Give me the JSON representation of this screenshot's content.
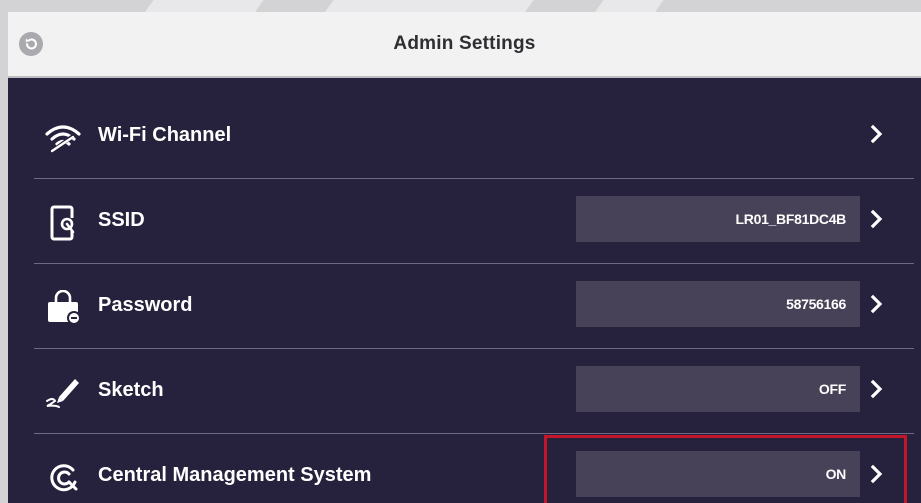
{
  "header": {
    "title": "Admin Settings"
  },
  "settings": {
    "items": [
      {
        "label": "Wi-Fi Channel",
        "icon": "wifi-icon",
        "value": ""
      },
      {
        "label": "SSID",
        "icon": "tablet-settings-icon",
        "value": "LR01_BF81DC4B"
      },
      {
        "label": "Password",
        "icon": "lock-bag-icon",
        "value": "58756166"
      },
      {
        "label": "Sketch",
        "icon": "pen-icon",
        "value": "OFF"
      },
      {
        "label": "Central Management System",
        "icon": "cms-icon",
        "value": "ON"
      }
    ]
  },
  "colors": {
    "panel_background": "#26213c",
    "value_box": "#474257",
    "highlight_border": "#c4162a",
    "header_background": "#f2f2f3"
  }
}
